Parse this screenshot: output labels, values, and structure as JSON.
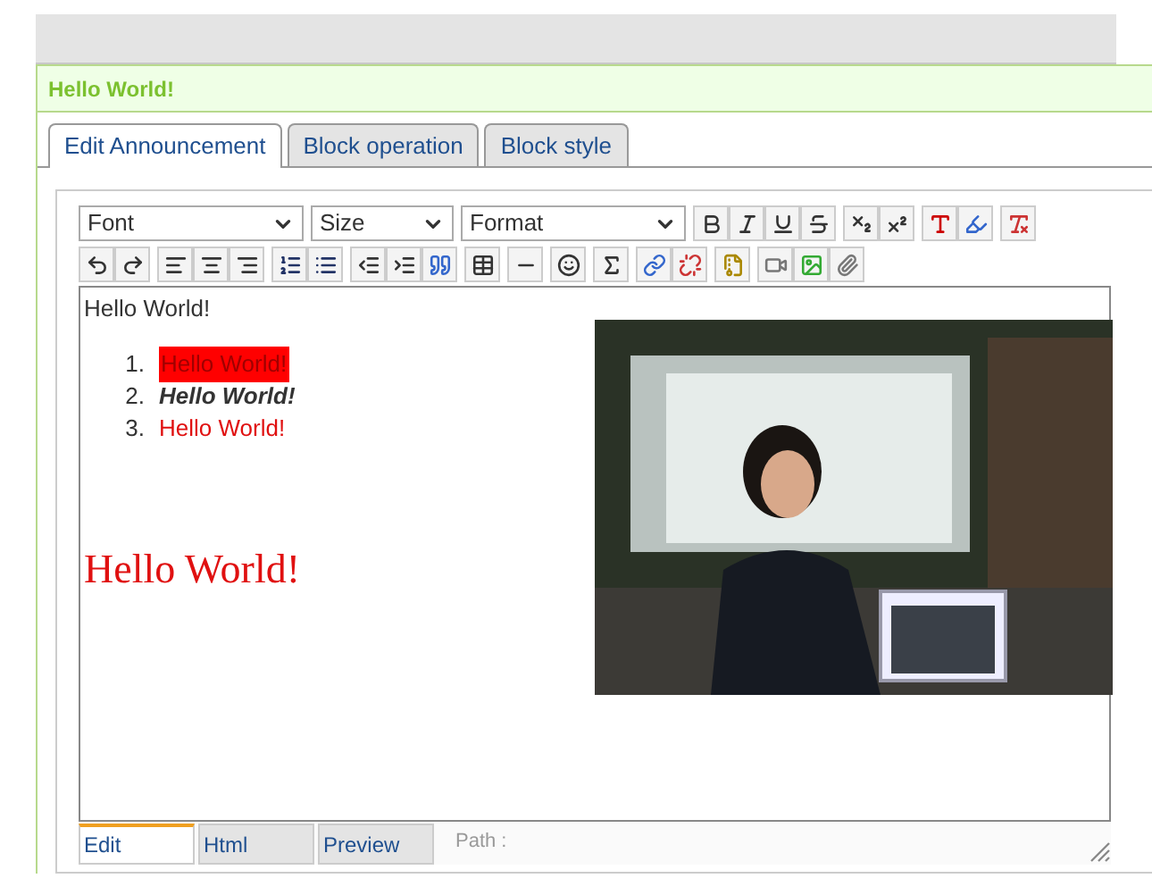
{
  "block_title": "Hello World!",
  "tabs": [
    {
      "label": "Edit Announcement",
      "selected": true
    },
    {
      "label": "Block operation",
      "selected": false
    },
    {
      "label": "Block style",
      "selected": false
    }
  ],
  "toolbar": {
    "selects": [
      "Font",
      "Size",
      "Format"
    ]
  },
  "content": {
    "first_line": "Hello World!",
    "list": [
      {
        "number": "1.",
        "text": "Hello World!",
        "kind": "highlight"
      },
      {
        "number": "2.",
        "text": "Hello World!",
        "kind": "bold_italic"
      },
      {
        "number": "3.",
        "text": "Hello World!",
        "kind": "red"
      }
    ],
    "large_text": "Hello World!"
  },
  "mode_tabs": [
    {
      "label": "Edit",
      "selected": true
    },
    {
      "label": "Html",
      "selected": false
    },
    {
      "label": "Preview",
      "selected": false
    }
  ],
  "path_label": "Path :"
}
